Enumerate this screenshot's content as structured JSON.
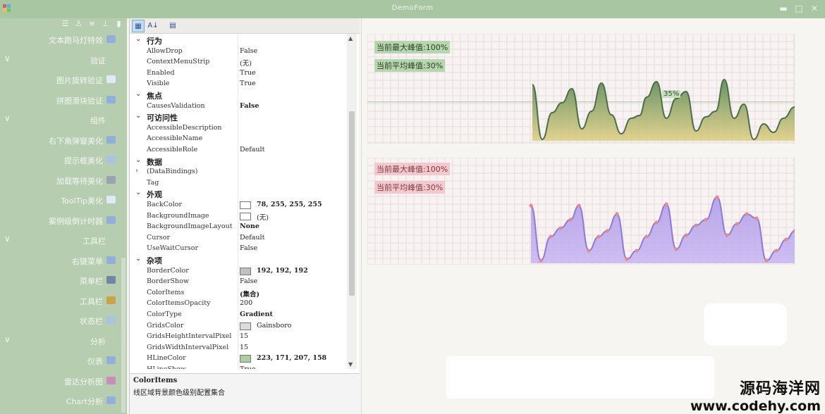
{
  "window": {
    "title": "DemoForm"
  },
  "sidebar": {
    "items": [
      {
        "label": "文本跑马灯特效",
        "kind": "item",
        "icon": "marquee-icon",
        "color": "#8fb0d8"
      },
      {
        "label": "验证",
        "kind": "group"
      },
      {
        "label": "图片旋转验证",
        "kind": "item",
        "icon": "hash-icon",
        "color": "#dfe9f7"
      },
      {
        "label": "拼图滑块验证",
        "kind": "item",
        "icon": "puzzle-icon",
        "color": "#8fb0d8"
      },
      {
        "label": "组件",
        "kind": "group"
      },
      {
        "label": "右下角弹窗美化",
        "kind": "item",
        "icon": "popup-icon",
        "color": "#8fb0d8"
      },
      {
        "label": "提示框美化",
        "kind": "item",
        "icon": "tooltip-icon",
        "color": "#a9c3e3"
      },
      {
        "label": "加载等待美化",
        "kind": "item",
        "icon": "hourglass-icon",
        "color": "#9aa3ae"
      },
      {
        "label": "ToolTip美化",
        "kind": "item",
        "icon": "message-icon",
        "color": "#dfe9f7"
      },
      {
        "label": "案例级倒计时器",
        "kind": "item",
        "icon": "timer-icon",
        "color": "#8fb0d8"
      },
      {
        "label": "工具栏",
        "kind": "group"
      },
      {
        "label": "右键菜单",
        "kind": "item",
        "icon": "context-menu-icon",
        "color": "#8fb0d8"
      },
      {
        "label": "菜单栏",
        "kind": "item",
        "icon": "menubar-icon",
        "color": "#6f86a6"
      },
      {
        "label": "工具栏",
        "kind": "item",
        "icon": "toolbar-icon",
        "color": "#c9a24a"
      },
      {
        "label": "状态栏",
        "kind": "item",
        "icon": "statusbar-icon",
        "color": "#a9c3e3"
      },
      {
        "label": "分析",
        "kind": "group"
      },
      {
        "label": "仪表",
        "kind": "item",
        "icon": "gauge-icon",
        "color": "#8fb0d8"
      },
      {
        "label": "雷达分析图",
        "kind": "item",
        "icon": "radar-icon",
        "color": "#c78fb7"
      },
      {
        "label": "Chart分析",
        "kind": "item",
        "icon": "chart-icon",
        "color": "#8fb0d8"
      }
    ]
  },
  "property_grid": {
    "rows": [
      {
        "type": "cat",
        "name": "行为"
      },
      {
        "type": "prop",
        "name": "AllowDrop",
        "value": "False"
      },
      {
        "type": "prop",
        "name": "ContextMenuStrip",
        "value": "(无)"
      },
      {
        "type": "prop",
        "name": "Enabled",
        "value": "True"
      },
      {
        "type": "prop",
        "name": "Visible",
        "value": "True"
      },
      {
        "type": "cat",
        "name": "焦点"
      },
      {
        "type": "prop",
        "name": "CausesValidation",
        "value": "False",
        "bold": true
      },
      {
        "type": "cat",
        "name": "可访问性"
      },
      {
        "type": "prop",
        "name": "AccessibleDescription",
        "value": ""
      },
      {
        "type": "prop",
        "name": "AccessibleName",
        "value": ""
      },
      {
        "type": "prop",
        "name": "AccessibleRole",
        "value": "Default"
      },
      {
        "type": "cat",
        "name": "数据"
      },
      {
        "type": "prop",
        "name": "(DataBindings)",
        "value": "",
        "expand": true
      },
      {
        "type": "prop",
        "name": "Tag",
        "value": ""
      },
      {
        "type": "cat",
        "name": "外观"
      },
      {
        "type": "prop",
        "name": "BackColor",
        "value": "78, 255, 255, 255",
        "swatch": "#ffffff",
        "bold": true
      },
      {
        "type": "prop",
        "name": "BackgroundImage",
        "value": "(无)",
        "swatch": "#ffffff"
      },
      {
        "type": "prop",
        "name": "BackgroundImageLayout",
        "value": "None",
        "bold": true
      },
      {
        "type": "prop",
        "name": "Cursor",
        "value": "Default"
      },
      {
        "type": "prop",
        "name": "UseWaitCursor",
        "value": "False"
      },
      {
        "type": "cat",
        "name": "杂项"
      },
      {
        "type": "prop",
        "name": "BorderColor",
        "value": "192, 192, 192",
        "swatch": "#c0c0c0",
        "bold": true
      },
      {
        "type": "prop",
        "name": "BorderShow",
        "value": "False"
      },
      {
        "type": "prop",
        "name": "ColorItems",
        "value": "(集合)",
        "bold": true
      },
      {
        "type": "prop",
        "name": "ColorItemsOpacity",
        "value": "200"
      },
      {
        "type": "prop",
        "name": "ColorType",
        "value": "Gradient",
        "bold": true
      },
      {
        "type": "prop",
        "name": "GridsColor",
        "value": "Gainsboro",
        "swatch": "#dcdcdc"
      },
      {
        "type": "prop",
        "name": "GridsHeightIntervalPixel",
        "value": "15"
      },
      {
        "type": "prop",
        "name": "GridsWidthIntervalPixel",
        "value": "15"
      },
      {
        "type": "prop",
        "name": "HLineColor",
        "value": "223, 171, 207, 158",
        "swatch": "#abcf9e",
        "bold": true
      },
      {
        "type": "prop",
        "name": "HLineShow",
        "value": "True"
      }
    ],
    "help": {
      "title": "ColorItems",
      "description": "线区域背景颜色级别配置集合"
    }
  },
  "charts": [
    {
      "max_label": "当前最大峰值:100%",
      "avg_label": "当前平均峰值:30%",
      "peak_marker": "35%",
      "line_color": "#4c6f48",
      "fill_top": "#5d8a57",
      "fill_bottom": "#e0cf85"
    },
    {
      "max_label": "当前最大峰值:100%",
      "avg_label": "当前平均峰值:30%",
      "line_color": "#8f7ad6",
      "fill_top": "#b39de8",
      "fill_bottom": "#c9b8f2",
      "point_color": "#e48b8b"
    }
  ],
  "watermark": {
    "line1": "源码海洋网",
    "line2": "www.codehy.com"
  }
}
